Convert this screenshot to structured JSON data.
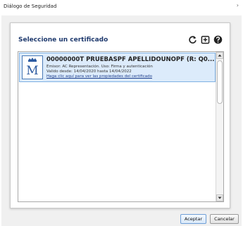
{
  "window": {
    "title": "Diálogo de Seguridad",
    "close_symbol": "›"
  },
  "panel": {
    "title": "Seleccione un certificado",
    "toolbar_icons": [
      "refresh-icon",
      "import-icon",
      "help-icon"
    ]
  },
  "certificates": [
    {
      "name": "00000000T PRUEBASPF APELLIDOUNOPF (R: Q0...",
      "issuer_line": "Emisor: AC Representación. Uso: Firma y autenticación",
      "validity_line": "Valido desde: 14/04/2020 hasta 14/04/2022",
      "properties_link": "Haga clic aquí para ver las propiedades del certificado",
      "selected": true
    }
  ],
  "buttons": {
    "accept": "Aceptar",
    "cancel": "Cancelar"
  },
  "colors": {
    "panel_title": "#1f3a6e",
    "selected_item_bg": "#dcebfb",
    "selected_item_border": "#7fb1e3",
    "link": "#1a3b8a"
  }
}
